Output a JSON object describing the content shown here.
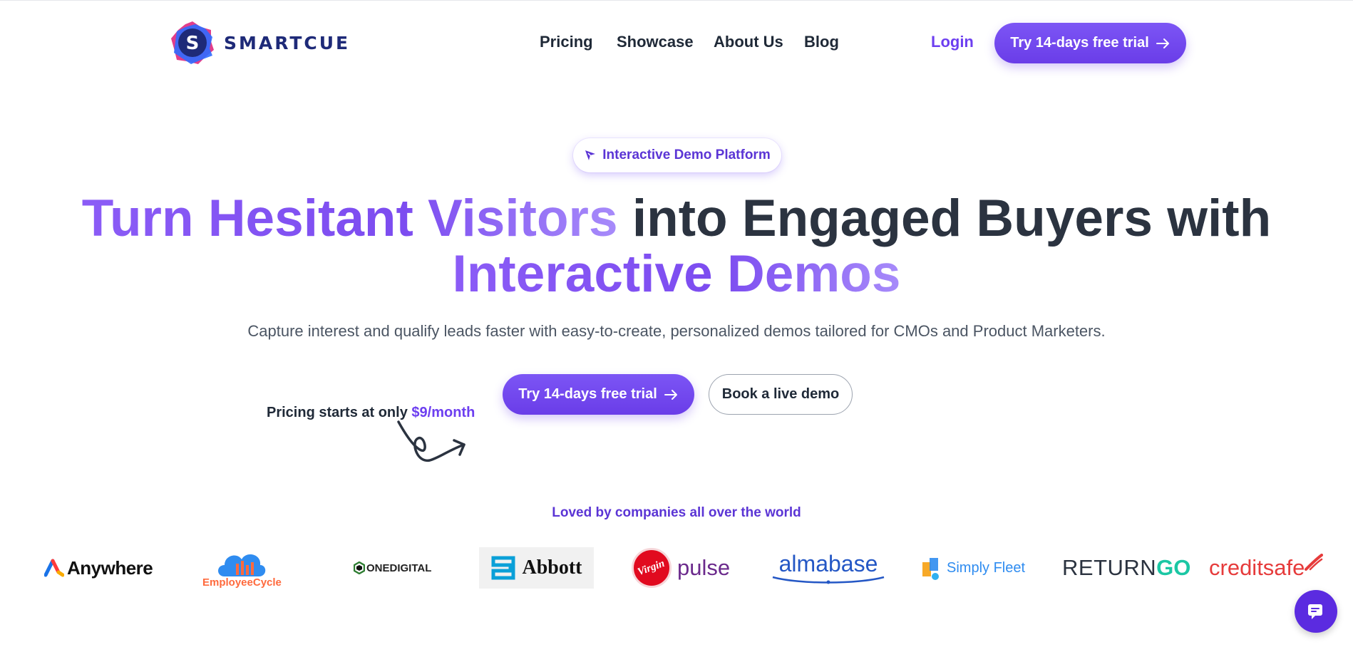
{
  "brand": {
    "name": "SMARTCUE",
    "accent": "#6d3ff0",
    "logo_letter": "S"
  },
  "nav": {
    "items": [
      {
        "label": "Pricing"
      },
      {
        "label": "Showcase"
      },
      {
        "label": "About Us"
      },
      {
        "label": "Blog"
      }
    ],
    "login_label": "Login",
    "cta_label": "Try 14-days free trial"
  },
  "hero": {
    "badge_label": "Interactive Demo Platform",
    "headline_part1": "Turn Hesitant Visitors",
    "headline_part2": " into Engaged Buyers with",
    "headline_part3": "Interactive Demos",
    "subtitle": "Capture interest and qualify leads faster with easy-to-create, personalized demos tailored for CMOs and Product Marketers.",
    "primary_cta": "Try 14-days free trial",
    "secondary_cta": "Book a live demo",
    "pricing_prefix": "Pricing starts at only ",
    "pricing_value": "$9/month"
  },
  "clients": {
    "heading": "Loved by companies all over the world",
    "logos": [
      {
        "name": "Anywhere",
        "icon": "anywhere-logo"
      },
      {
        "name": "EmployeeCycle",
        "icon": "employeecycle-logo"
      },
      {
        "name": "ONEDIGITAL",
        "icon": "onedigital-logo"
      },
      {
        "name": "Abbott",
        "icon": "abbott-logo"
      },
      {
        "name": "pulse",
        "prefix": "Virgin",
        "icon": "virgin-pulse-logo"
      },
      {
        "name": "almabase",
        "icon": "almabase-logo"
      },
      {
        "name": "Simply Fleet",
        "icon": "simply-fleet-logo"
      },
      {
        "name_part1": "RETURN",
        "name_part2": "GO",
        "icon": "returngo-logo"
      },
      {
        "name": "creditsafe",
        "icon": "creditsafe-logo"
      }
    ]
  },
  "chat": {
    "icon": "chat-icon"
  }
}
